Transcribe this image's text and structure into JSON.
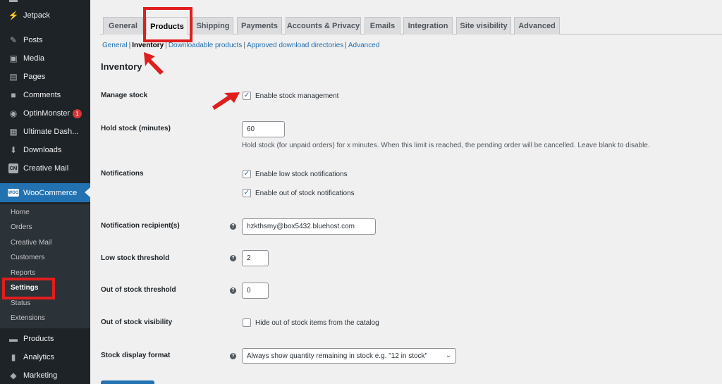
{
  "sidebar": {
    "items": [
      {
        "label": "Jetpack",
        "icon": "jetpack-icon",
        "glyph": "⚡"
      },
      {
        "label": "Posts",
        "icon": "pin-icon",
        "glyph": "📌"
      },
      {
        "label": "Media",
        "icon": "media-icon",
        "glyph": "▣"
      },
      {
        "label": "Pages",
        "icon": "pages-icon",
        "glyph": "▤"
      },
      {
        "label": "Comments",
        "icon": "comments-icon",
        "glyph": "■"
      },
      {
        "label": "OptinMonster",
        "icon": "optinmonster-icon",
        "glyph": "◉",
        "badge": "1"
      },
      {
        "label": "Ultimate Dash...",
        "icon": "dashboard-icon",
        "glyph": "▦"
      },
      {
        "label": "Downloads",
        "icon": "download-icon",
        "glyph": "⬇"
      },
      {
        "label": "Creative Mail",
        "icon": "creative-mail-icon",
        "glyph": "CM"
      }
    ],
    "woocommerce": {
      "label": "WooCommerce",
      "logo": "WOO"
    },
    "submenu": [
      "Home",
      "Orders",
      "Creative Mail",
      "Customers",
      "Reports",
      "Settings",
      "Status",
      "Extensions"
    ],
    "bottom_items": [
      {
        "label": "Products",
        "icon": "products-icon",
        "glyph": "▬"
      },
      {
        "label": "Analytics",
        "icon": "analytics-icon",
        "glyph": "▮"
      },
      {
        "label": "Marketing",
        "icon": "marketing-icon",
        "glyph": "📣"
      }
    ]
  },
  "tabs": [
    "General",
    "Products",
    "Shipping",
    "Payments",
    "Accounts & Privacy",
    "Emails",
    "Integration",
    "Site visibility",
    "Advanced"
  ],
  "active_tab": "Products",
  "subnav": [
    "General",
    "Inventory",
    "Downloadable products",
    "Approved download directories",
    "Advanced"
  ],
  "active_subnav": "Inventory",
  "section_title": "Inventory",
  "fields": {
    "manage_stock": {
      "label": "Manage stock",
      "checkbox_label": "Enable stock management",
      "checked": true
    },
    "hold_stock": {
      "label": "Hold stock (minutes)",
      "value": "60",
      "description": "Hold stock (for unpaid orders) for x minutes. When this limit is reached, the pending order will be cancelled. Leave blank to disable."
    },
    "notifications": {
      "label": "Notifications",
      "low_stock_label": "Enable low stock notifications",
      "out_of_stock_label": "Enable out of stock notifications"
    },
    "recipient": {
      "label": "Notification recipient(s)",
      "value": "hzkthsmy@box5432.bluehost.com"
    },
    "low_threshold": {
      "label": "Low stock threshold",
      "value": "2"
    },
    "out_threshold": {
      "label": "Out of stock threshold",
      "value": "0"
    },
    "visibility": {
      "label": "Out of stock visibility",
      "checkbox_label": "Hide out of stock items from the catalog",
      "checked": false
    },
    "display_format": {
      "label": "Stock display format",
      "value": "Always show quantity remaining in stock e.g. \"12 in stock\""
    }
  },
  "help_glyph": "?",
  "check_glyph": "✓",
  "chevron_glyph": "⌄",
  "colors": {
    "accent": "#2271b1",
    "annotation": "#e01e1e",
    "sidebar": "#1d2327"
  }
}
